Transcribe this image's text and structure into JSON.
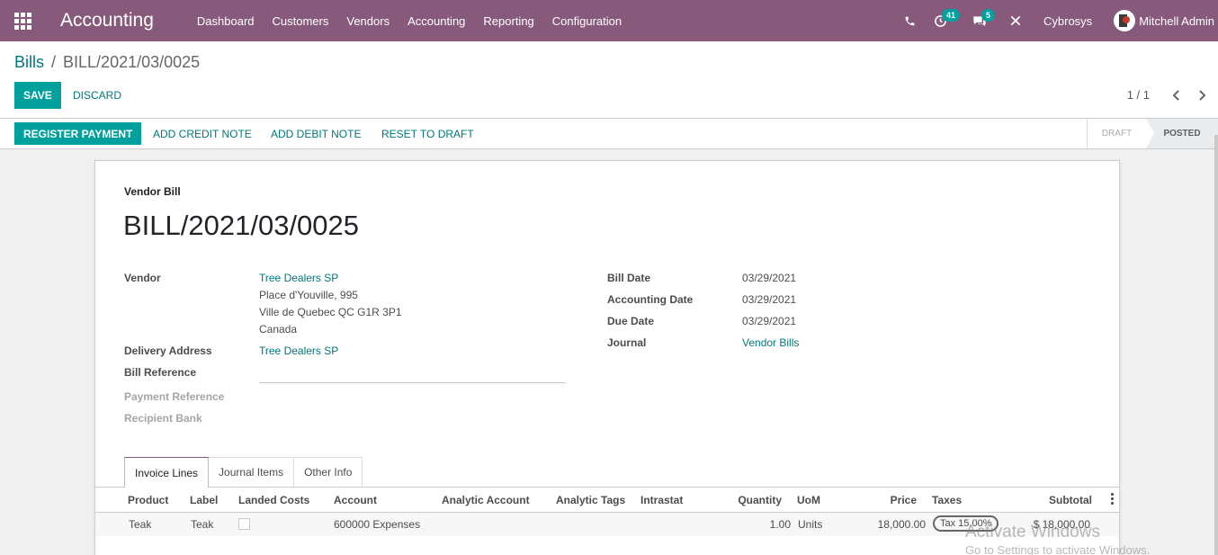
{
  "navbar": {
    "app_name": "Accounting",
    "menu": [
      "Dashboard",
      "Customers",
      "Vendors",
      "Accounting",
      "Reporting",
      "Configuration"
    ],
    "activity_count": "41",
    "message_count": "5",
    "company": "Cybrosys",
    "user": "Mitchell Admin",
    "bg_color": "#875a7b"
  },
  "control_panel": {
    "breadcrumb_parent": "Bills",
    "breadcrumb_separator": "/",
    "breadcrumb_current": "BILL/2021/03/0025",
    "save_label": "SAVE",
    "discard_label": "DISCARD",
    "pager": "1 / 1"
  },
  "statusbar": {
    "register_payment": "REGISTER PAYMENT",
    "add_credit_note": "ADD CREDIT NOTE",
    "add_debit_note": "ADD DEBIT NOTE",
    "reset_to_draft": "RESET TO DRAFT",
    "stage_draft": "DRAFT",
    "stage_posted": "POSTED"
  },
  "form": {
    "type_label": "Vendor Bill",
    "title": "BILL/2021/03/0025",
    "vendor_label": "Vendor",
    "vendor_name": "Tree Dealers SP",
    "vendor_address_1": "Place d'Youville, 995",
    "vendor_address_2": "Ville de Quebec QC G1R 3P1",
    "vendor_address_3": "Canada",
    "delivery_address_label": "Delivery Address",
    "delivery_address": "Tree Dealers SP",
    "bill_reference_label": "Bill Reference",
    "payment_reference_label": "Payment Reference",
    "recipient_bank_label": "Recipient Bank",
    "bill_date_label": "Bill Date",
    "bill_date": "03/29/2021",
    "accounting_date_label": "Accounting Date",
    "accounting_date": "03/29/2021",
    "due_date_label": "Due Date",
    "due_date": "03/29/2021",
    "journal_label": "Journal",
    "journal": "Vendor Bills"
  },
  "tabs": [
    "Invoice Lines",
    "Journal Items",
    "Other Info"
  ],
  "table": {
    "headers": {
      "product": "Product",
      "label": "Label",
      "landed_costs": "Landed Costs",
      "account": "Account",
      "analytic_account": "Analytic Account",
      "analytic_tags": "Analytic Tags",
      "intrastat": "Intrastat",
      "quantity": "Quantity",
      "uom": "UoM",
      "price": "Price",
      "taxes": "Taxes",
      "subtotal": "Subtotal"
    },
    "rows": [
      {
        "product": "Teak",
        "label": "Teak",
        "account": "600000 Expenses",
        "quantity": "1.00",
        "uom": "Units",
        "price": "18,000.00",
        "tax": "Tax 15.00%",
        "subtotal": "$ 18,000.00"
      }
    ]
  },
  "watermark": {
    "title": "Activate Windows",
    "subtitle": "Go to Settings to activate Windows."
  }
}
